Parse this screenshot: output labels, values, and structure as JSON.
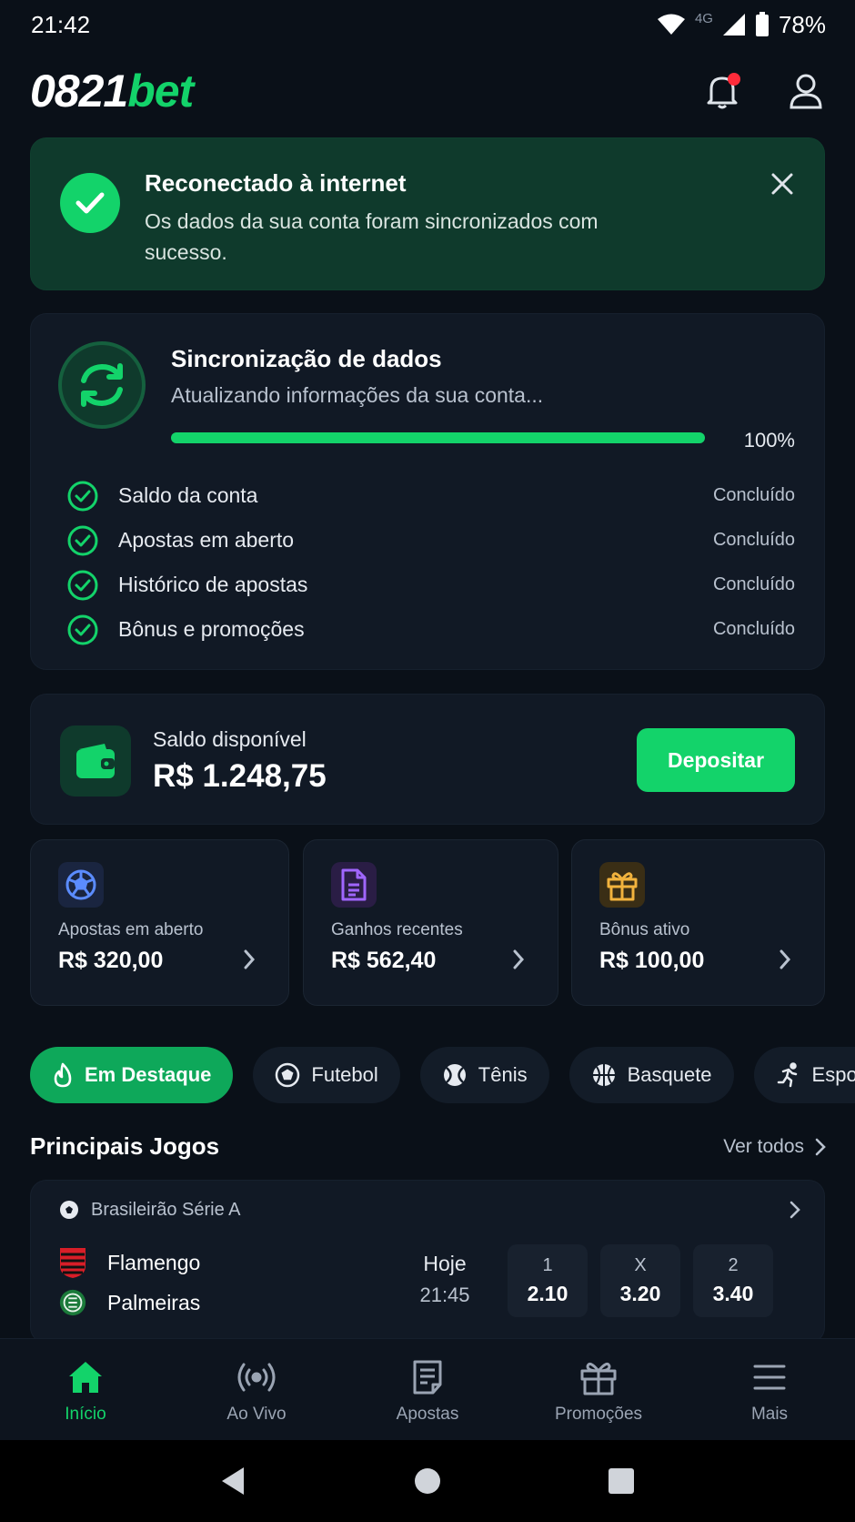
{
  "status_bar": {
    "time": "21:42",
    "network": "4G",
    "battery": "78%"
  },
  "header": {
    "logo_part1": "0821",
    "logo_part2": "bet"
  },
  "toast": {
    "title": "Reconectado à internet",
    "message": "Os dados da sua conta foram sincronizados com sucesso."
  },
  "sync": {
    "title": "Sincronização de dados",
    "subtitle": "Atualizando informações da sua conta...",
    "progress": 100,
    "progress_label": "100%",
    "items": [
      {
        "label": "Saldo da conta",
        "status": "Concluído"
      },
      {
        "label": "Apostas em aberto",
        "status": "Concluído"
      },
      {
        "label": "Histórico de apostas",
        "status": "Concluído"
      },
      {
        "label": "Bônus e promoções",
        "status": "Concluído"
      }
    ]
  },
  "balance": {
    "label": "Saldo disponível",
    "value": "R$ 1.248,75",
    "deposit_label": "Depositar"
  },
  "stats": [
    {
      "label": "Apostas em aberto",
      "value": "R$ 320,00",
      "icon": "soccer-ball-icon",
      "color": "#5b8cff"
    },
    {
      "label": "Ganhos recentes",
      "value": "R$ 562,40",
      "icon": "document-icon",
      "color": "#a066ff"
    },
    {
      "label": "Bônus ativo",
      "value": "R$ 100,00",
      "icon": "gift-icon",
      "color": "#f2b33d"
    }
  ],
  "categories": [
    {
      "label": "Em Destaque",
      "icon": "flame-icon"
    },
    {
      "label": "Futebol",
      "icon": "soccer-ball-icon"
    },
    {
      "label": "Tênis",
      "icon": "tennis-ball-icon"
    },
    {
      "label": "Basquete",
      "icon": "basketball-icon"
    },
    {
      "label": "Esport",
      "icon": "runner-icon"
    }
  ],
  "section": {
    "title": "Principais Jogos",
    "see_all": "Ver todos"
  },
  "match": {
    "league": "Brasileirão Série A",
    "team1": "Flamengo",
    "team2": "Palmeiras",
    "day": "Hoje",
    "time": "21:45",
    "odds": [
      {
        "key": "1",
        "value": "2.10"
      },
      {
        "key": "X",
        "value": "3.20"
      },
      {
        "key": "2",
        "value": "3.40"
      }
    ]
  },
  "bottom_nav": [
    {
      "label": "Início",
      "icon": "home-icon"
    },
    {
      "label": "Ao Vivo",
      "icon": "live-icon"
    },
    {
      "label": "Apostas",
      "icon": "bets-icon"
    },
    {
      "label": "Promoções",
      "icon": "gift-icon"
    },
    {
      "label": "Mais",
      "icon": "menu-icon"
    }
  ],
  "colors": {
    "accent": "#13d36a",
    "background": "#0a1018",
    "card": "#111925"
  }
}
